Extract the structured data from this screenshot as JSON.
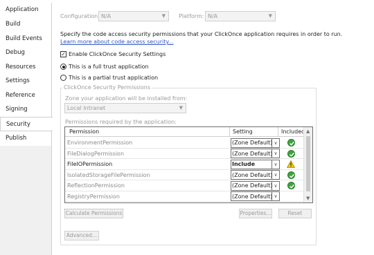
{
  "tabs": [
    "Application",
    "Build",
    "Build Events",
    "Debug",
    "Resources",
    "Settings",
    "Reference Paths",
    "Signing",
    "Security",
    "Publish"
  ],
  "active_tab": "Security",
  "config": {
    "configuration_label": "Configuration:",
    "configuration_value": "N/A",
    "platform_label": "Platform:",
    "platform_value": "N/A"
  },
  "intro_text": "Specify the code access security permissions that your ClickOnce application requires in order to run.",
  "learn_more_link": "Learn more about code access security...",
  "enable_checkbox": {
    "label": "Enable ClickOnce Security Settings",
    "checked": true
  },
  "trust": {
    "full_label": "This is a full trust application",
    "partial_label": "This is a partial trust application",
    "selected": "full"
  },
  "group": {
    "title": "ClickOnce Security Permissions",
    "zone_label": "Zone your application will be installed from:",
    "zone_value": "Local Intranet",
    "permissions_label": "Permissions required by the application:"
  },
  "grid": {
    "headers": {
      "permission": "Permission",
      "setting": "Setting",
      "included": "Included"
    },
    "rows": [
      {
        "permission": "EnvironmentPermission",
        "setting": "(Zone Default)",
        "status": "ok"
      },
      {
        "permission": "FileDialogPermission",
        "setting": "(Zone Default)",
        "status": "ok"
      },
      {
        "permission": "FileIOPermission",
        "setting": "Include",
        "status": "warning",
        "bold": true
      },
      {
        "permission": "IsolatedStorageFilePermission",
        "setting": "(Zone Default)",
        "status": "ok"
      },
      {
        "permission": "ReflectionPermission",
        "setting": "(Zone Default)",
        "status": "ok"
      },
      {
        "permission": "RegistryPermission",
        "setting": "(Zone Default)",
        "status": "none"
      }
    ]
  },
  "buttons": {
    "calculate": "Calculate Permissions",
    "properties": "Properties...",
    "reset": "Reset",
    "advanced": "Advanced..."
  },
  "colors": {
    "link": "#2f56c9",
    "ok_icon": "#3ea33e",
    "warning_icon": "#f2c811"
  }
}
